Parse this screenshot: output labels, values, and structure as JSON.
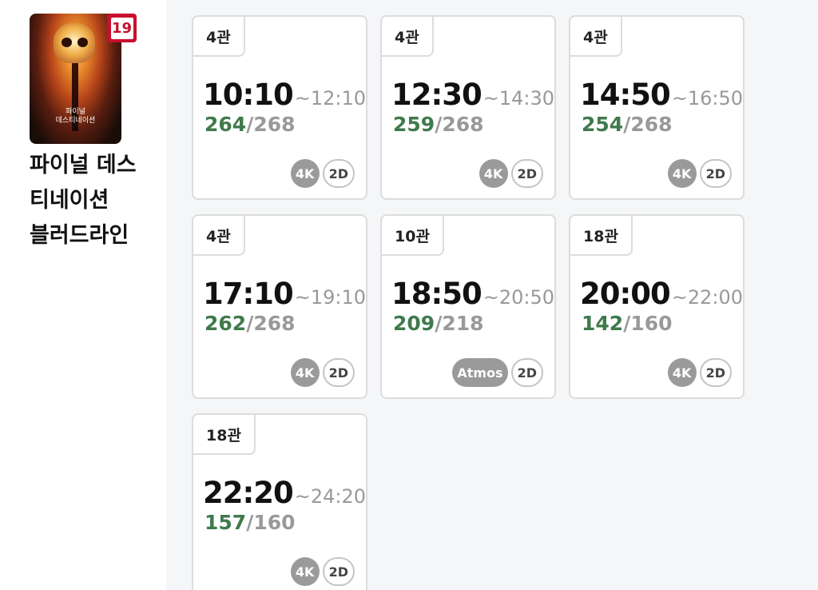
{
  "movie": {
    "poster_title_line1": "파이널",
    "poster_title_line2": "데스티네이션",
    "rating": "19",
    "title_line1": "파이널 데스",
    "title_line2": "티네이션",
    "title_line3": "블러드라인"
  },
  "showtimes": [
    {
      "hall": "4관",
      "start": "10:10",
      "end": "~12:10",
      "available": "264",
      "total": "/268",
      "format": "4K",
      "dimension": "2D"
    },
    {
      "hall": "4관",
      "start": "12:30",
      "end": "~14:30",
      "available": "259",
      "total": "/268",
      "format": "4K",
      "dimension": "2D"
    },
    {
      "hall": "4관",
      "start": "14:50",
      "end": "~16:50",
      "available": "254",
      "total": "/268",
      "format": "4K",
      "dimension": "2D"
    },
    {
      "hall": "4관",
      "start": "17:10",
      "end": "~19:10",
      "available": "262",
      "total": "/268",
      "format": "4K",
      "dimension": "2D"
    },
    {
      "hall": "10관",
      "start": "18:50",
      "end": "~20:50",
      "available": "209",
      "total": "/218",
      "format": "Atmos",
      "dimension": "2D"
    },
    {
      "hall": "18관",
      "start": "20:00",
      "end": "~22:00",
      "available": "142",
      "total": "/160",
      "format": "4K",
      "dimension": "2D"
    },
    {
      "hall": "18관",
      "start": "22:20",
      "end": "~24:20",
      "available": "157",
      "total": "/160",
      "format": "4K",
      "dimension": "2D"
    }
  ],
  "colors": {
    "available_seats": "#3f7a4c",
    "rating_badge": "#c8102e",
    "format_badge": "#9a9a9a"
  }
}
